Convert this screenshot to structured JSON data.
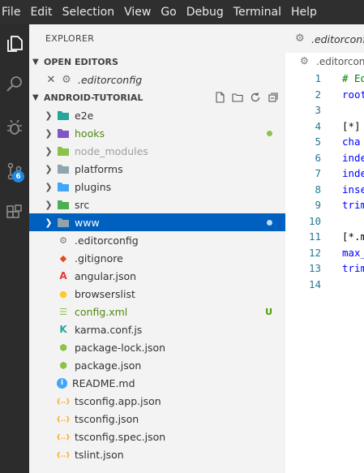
{
  "menu": [
    "File",
    "Edit",
    "Selection",
    "View",
    "Go",
    "Debug",
    "Terminal",
    "Help"
  ],
  "activity": {
    "scm_badge": "6"
  },
  "sidebar": {
    "title": "EXPLORER",
    "open_editors_label": "OPEN EDITORS",
    "open_editor_file": ".editorconfig",
    "project_label": "ANDROID-TUTORIAL",
    "items": [
      {
        "label": "e2e",
        "kind": "folder",
        "icon": "folder-e2e-icon",
        "color": "#26a69a",
        "text_color": "#333333"
      },
      {
        "label": "hooks",
        "kind": "folder",
        "icon": "folder-hooks-icon",
        "color": "#7e57c2",
        "text_color": "#4e8a0e",
        "dot": "#8bc34a"
      },
      {
        "label": "node_modules",
        "kind": "folder",
        "icon": "folder-node-icon",
        "color": "#8bc34a",
        "text_color": "#9e9e9e"
      },
      {
        "label": "platforms",
        "kind": "folder",
        "icon": "folder-icon",
        "color": "#90a4ae",
        "text_color": "#333333"
      },
      {
        "label": "plugins",
        "kind": "folder",
        "icon": "folder-plugin-icon",
        "color": "#42a5f5",
        "text_color": "#333333"
      },
      {
        "label": "src",
        "kind": "folder",
        "icon": "folder-src-icon",
        "color": "#4caf50",
        "text_color": "#333333"
      },
      {
        "label": "www",
        "kind": "folder",
        "icon": "folder-icon",
        "color": "#90a4ae",
        "text_color": "#ffffff",
        "selected": true,
        "dot": "#bbdefb"
      },
      {
        "label": ".editorconfig",
        "kind": "file",
        "icon": "editorconfig-icon",
        "glyph": "⚙",
        "color": "#777777",
        "text_color": "#333333"
      },
      {
        "label": ".gitignore",
        "kind": "file",
        "icon": "git-icon",
        "glyph": "◆",
        "color": "#e64a19",
        "text_color": "#333333"
      },
      {
        "label": "angular.json",
        "kind": "file",
        "icon": "angular-icon",
        "glyph": "A",
        "color": "#e53935",
        "text_color": "#333333"
      },
      {
        "label": "browserslist",
        "kind": "file",
        "icon": "browserslist-icon",
        "glyph": "●",
        "color": "#ffca28",
        "text_color": "#333333"
      },
      {
        "label": "config.xml",
        "kind": "file",
        "icon": "xml-icon",
        "glyph": "☰",
        "color": "#8bc34a",
        "text_color": "#4e8a0e",
        "git": "U"
      },
      {
        "label": "karma.conf.js",
        "kind": "file",
        "icon": "karma-icon",
        "glyph": "K",
        "color": "#26a69a",
        "text_color": "#333333"
      },
      {
        "label": "package-lock.json",
        "kind": "file",
        "icon": "nodejs-icon",
        "glyph": "⬢",
        "color": "#8bc34a",
        "text_color": "#333333"
      },
      {
        "label": "package.json",
        "kind": "file",
        "icon": "nodejs-icon",
        "glyph": "⬢",
        "color": "#8bc34a",
        "text_color": "#333333"
      },
      {
        "label": "README.md",
        "kind": "file",
        "icon": "info-icon",
        "glyph": "i",
        "color": "#42a5f5",
        "text_color": "#333333"
      },
      {
        "label": "tsconfig.app.json",
        "kind": "file",
        "icon": "json-icon",
        "glyph": "{..}",
        "color": "#f9a825",
        "text_color": "#333333"
      },
      {
        "label": "tsconfig.json",
        "kind": "file",
        "icon": "json-icon",
        "glyph": "{..}",
        "color": "#f9a825",
        "text_color": "#333333"
      },
      {
        "label": "tsconfig.spec.json",
        "kind": "file",
        "icon": "json-icon",
        "glyph": "{..}",
        "color": "#f9a825",
        "text_color": "#333333"
      },
      {
        "label": "tslint.json",
        "kind": "file",
        "icon": "json-icon",
        "glyph": "{..}",
        "color": "#f9a825",
        "text_color": "#333333"
      }
    ]
  },
  "editor": {
    "tab_label": ".editorconfi",
    "breadcrumb": ".editorcon",
    "lines": [
      {
        "n": "1",
        "text": "# Ed",
        "color": "#008000"
      },
      {
        "n": "2",
        "text": "root",
        "color": "#0000ff"
      },
      {
        "n": "3",
        "text": "",
        "color": "#000000"
      },
      {
        "n": "4",
        "text": "[*]",
        "color": "#000000"
      },
      {
        "n": "5",
        "text": "cha",
        "color": "#0000ff"
      },
      {
        "n": "6",
        "text": "inde",
        "color": "#0000ff"
      },
      {
        "n": "7",
        "text": "inde",
        "color": "#0000ff"
      },
      {
        "n": "8",
        "text": "inse",
        "color": "#0000ff"
      },
      {
        "n": "9",
        "text": "trim",
        "color": "#0000ff"
      },
      {
        "n": "10",
        "text": "",
        "color": "#000000"
      },
      {
        "n": "11",
        "text": "[*.m",
        "color": "#000000"
      },
      {
        "n": "12",
        "text": "max_",
        "color": "#0000ff"
      },
      {
        "n": "13",
        "text": "trim",
        "color": "#0000ff"
      },
      {
        "n": "14",
        "text": "",
        "color": "#000000"
      }
    ]
  }
}
